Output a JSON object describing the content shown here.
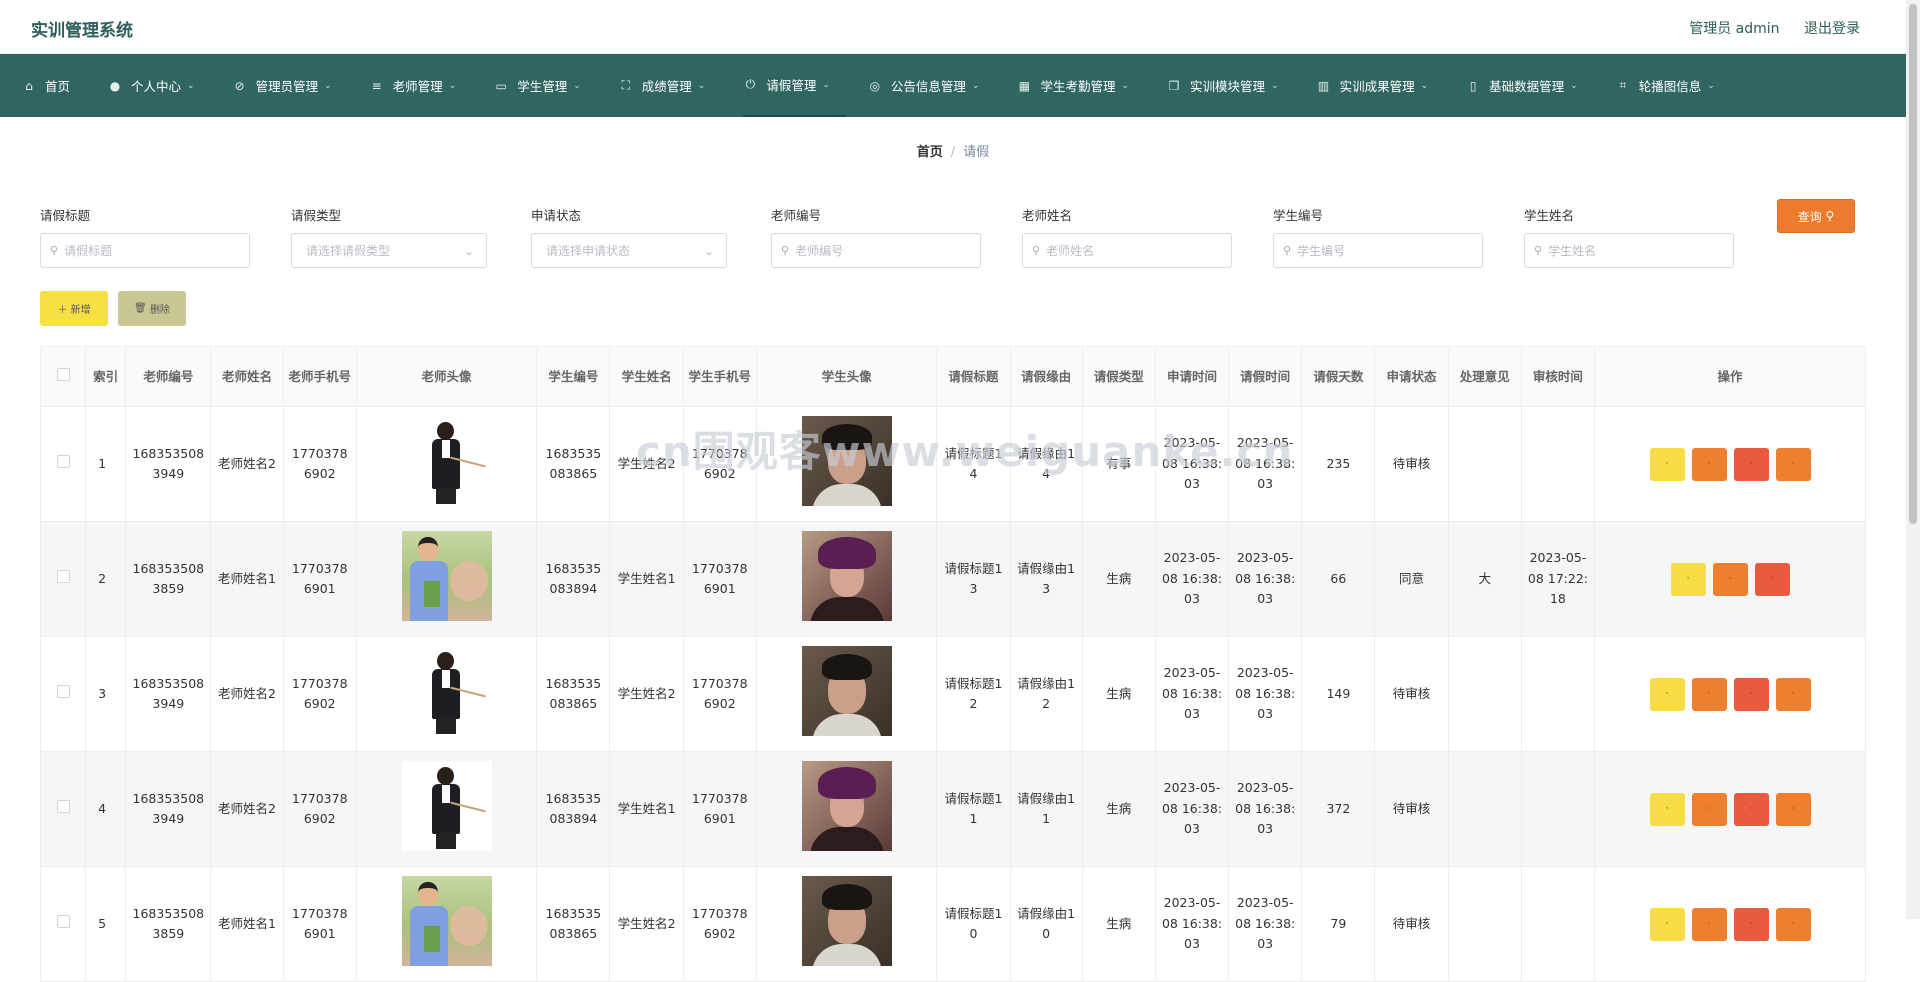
{
  "app": {
    "title": "实训管理系统",
    "admin": "管理员 admin",
    "logout": "退出登录"
  },
  "nav": [
    {
      "label": "首页",
      "icon": "home-icon",
      "glyph": "⌂",
      "chevron": ""
    },
    {
      "label": "个人中心",
      "icon": "user-icon",
      "glyph": "●",
      "chevron": "⌄"
    },
    {
      "label": "管理员管理",
      "icon": "bell-off-icon",
      "glyph": "⊘",
      "chevron": "⌄"
    },
    {
      "label": "老师管理",
      "icon": "sliders-icon",
      "glyph": "≡",
      "chevron": "⌄"
    },
    {
      "label": "学生管理",
      "icon": "briefcase-icon",
      "glyph": "▭",
      "chevron": "⌄"
    },
    {
      "label": "成绩管理",
      "icon": "fullscreen-icon",
      "glyph": "⛶",
      "chevron": "⌄"
    },
    {
      "label": "请假管理",
      "icon": "power-icon",
      "glyph": "⏻",
      "chevron": "⌄"
    },
    {
      "label": "公告信息管理",
      "icon": "basketball-icon",
      "glyph": "◎",
      "chevron": "⌄"
    },
    {
      "label": "学生考勤管理",
      "icon": "grid-icon",
      "glyph": "▦",
      "chevron": "⌄"
    },
    {
      "label": "实训模块管理",
      "icon": "copy-icon",
      "glyph": "❐",
      "chevron": "⌄"
    },
    {
      "label": "实训成果管理",
      "icon": "chart-icon",
      "glyph": "▥",
      "chevron": "⌄"
    },
    {
      "label": "基础数据管理",
      "icon": "mobile-icon",
      "glyph": "▯",
      "chevron": "⌄"
    },
    {
      "label": "轮播图信息",
      "icon": "crop-icon",
      "glyph": "⌗",
      "chevron": "⌄"
    }
  ],
  "breadcrumb": {
    "home": "首页",
    "sep": "/",
    "current": "请假"
  },
  "filters": [
    {
      "label": "请假标题",
      "placeholder": "请假标题",
      "type": "input"
    },
    {
      "label": "请假类型",
      "placeholder": "请选择请假类型",
      "type": "select"
    },
    {
      "label": "申请状态",
      "placeholder": "请选择申请状态",
      "type": "select"
    },
    {
      "label": "老师编号",
      "placeholder": "老师编号",
      "type": "input"
    },
    {
      "label": "老师姓名",
      "placeholder": "老师姓名",
      "type": "input"
    },
    {
      "label": "学生编号",
      "placeholder": "学生编号",
      "type": "input"
    },
    {
      "label": "学生姓名",
      "placeholder": "学生姓名",
      "type": "input"
    }
  ],
  "buttons": {
    "search": "查询",
    "add": "新增",
    "del": "删除"
  },
  "table": {
    "headers": [
      "",
      "索引",
      "老师编号",
      "老师姓名",
      "老师手机号",
      "老师头像",
      "学生编号",
      "学生姓名",
      "学生手机号",
      "学生头像",
      "请假标题",
      "请假缘由",
      "请假类型",
      "申请时间",
      "请假时间",
      "请假天数",
      "申请状态",
      "处理意见",
      "审核时间",
      "操作"
    ],
    "rows": [
      {
        "idx": "1",
        "tno": "1683535083949",
        "tname": "老师姓名2",
        "tphone": "17703786902",
        "tavatar": "a",
        "sno": "1683535083865",
        "sname": "学生姓名2",
        "sphone": "17703786902",
        "savatar": "a",
        "title": "请假标题14",
        "reason": "请假缘由14",
        "type": "有事",
        "apply": "2023-05-08 16:38:03",
        "leave": "2023-05-08 16:38:03",
        "days": "235",
        "status": "待审核",
        "opinion": "",
        "audit": "",
        "ops": 4
      },
      {
        "idx": "2",
        "tno": "1683535083859",
        "tname": "老师姓名1",
        "tphone": "17703786901",
        "tavatar": "b",
        "sno": "1683535083894",
        "sname": "学生姓名1",
        "sphone": "17703786901",
        "savatar": "b",
        "title": "请假标题13",
        "reason": "请假缘由13",
        "type": "生病",
        "apply": "2023-05-08 16:38:03",
        "leave": "2023-05-08 16:38:03",
        "days": "66",
        "status": "同意",
        "opinion": "大",
        "audit": "2023-05-08 17:22:18",
        "ops": 3
      },
      {
        "idx": "3",
        "tno": "1683535083949",
        "tname": "老师姓名2",
        "tphone": "17703786902",
        "tavatar": "a",
        "sno": "1683535083865",
        "sname": "学生姓名2",
        "sphone": "17703786902",
        "savatar": "a",
        "title": "请假标题12",
        "reason": "请假缘由12",
        "type": "生病",
        "apply": "2023-05-08 16:38:03",
        "leave": "2023-05-08 16:38:03",
        "days": "149",
        "status": "待审核",
        "opinion": "",
        "audit": "",
        "ops": 4
      },
      {
        "idx": "4",
        "tno": "1683535083949",
        "tname": "老师姓名2",
        "tphone": "17703786902",
        "tavatar": "a",
        "sno": "1683535083894",
        "sname": "学生姓名1",
        "sphone": "17703786901",
        "savatar": "b",
        "title": "请假标题11",
        "reason": "请假缘由11",
        "type": "生病",
        "apply": "2023-05-08 16:38:03",
        "leave": "2023-05-08 16:38:03",
        "days": "372",
        "status": "待审核",
        "opinion": "",
        "audit": "",
        "ops": 4
      },
      {
        "idx": "5",
        "tno": "1683535083859",
        "tname": "老师姓名1",
        "tphone": "17703786901",
        "tavatar": "b",
        "sno": "1683535083865",
        "sname": "学生姓名2",
        "sphone": "17703786902",
        "savatar": "a",
        "title": "请假标题10",
        "reason": "请假缘由10",
        "type": "生病",
        "apply": "2023-05-08 16:38:03",
        "leave": "2023-05-08 16:38:03",
        "days": "79",
        "status": "待审核",
        "opinion": "",
        "audit": "",
        "ops": 4
      }
    ]
  },
  "watermark": "cn围观客www.weiguanke.cn",
  "colors": {
    "nav_bg": "#2f6661",
    "brand": "#2d5e5a",
    "search": "#ee7b2d",
    "add": "#f7e044",
    "del": "#c9c893"
  }
}
